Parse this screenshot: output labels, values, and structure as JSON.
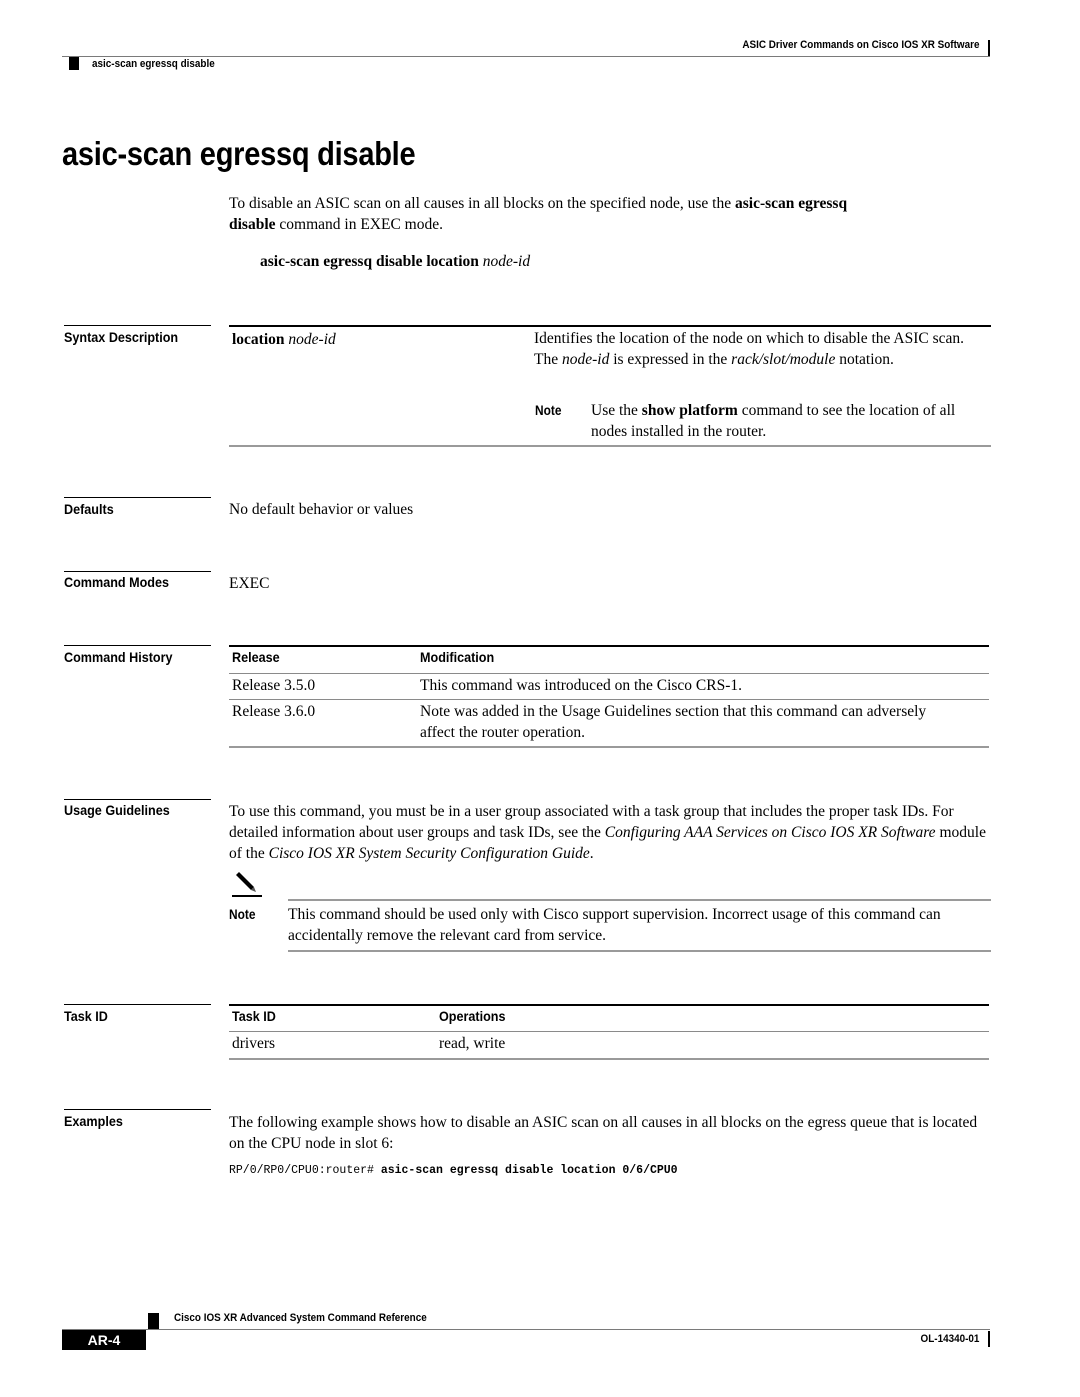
{
  "header": {
    "chapter": "ASIC Driver Commands on Cisco IOS XR Software",
    "running_title": "asic-scan egressq disable"
  },
  "title": "asic-scan egressq disable",
  "intro": {
    "text_1": "To disable an ASIC scan on all causes in all blocks on the specified node, use the ",
    "cmd_1": "asic-scan egressq",
    "cmd_2": "disable",
    "text_2": " command in EXEC mode."
  },
  "syntax": {
    "command": "asic-scan egressq disable location",
    "arg": "node-id"
  },
  "sections": {
    "syntax_description": "Syntax Description",
    "defaults": "Defaults",
    "command_modes": "Command Modes",
    "command_history": "Command History",
    "usage_guidelines": "Usage Guidelines",
    "task_id": "Task ID",
    "examples": "Examples"
  },
  "syntax_table": {
    "keyword": "location",
    "keyword_arg": "node-id",
    "desc_1": "Identifies the location of the node on which to disable the ASIC scan. The ",
    "desc_arg": "node-id",
    "desc_2": " is expressed in the ",
    "desc_fmt": "rack/slot/module",
    "desc_3": " notation.",
    "note_label": "Note",
    "note_1": "Use the ",
    "note_cmd": "show platform",
    "note_2": " command to see the location of all nodes installed in the router."
  },
  "defaults": "No default behavior or values",
  "command_modes": "EXEC",
  "history": {
    "headers": [
      "Release",
      "Modification"
    ],
    "rows": [
      {
        "release": "Release 3.5.0",
        "modification": "This command was introduced on the Cisco CRS-1."
      },
      {
        "release": "Release 3.6.0",
        "modification": "Note was added in the Usage Guidelines section that this command can adversely affect the router operation."
      }
    ]
  },
  "usage": {
    "text_1": "To use this command, you must be in a user group associated with a task group that includes the proper task IDs. For detailed information about user groups and task IDs, see the ",
    "ref_1": "Configuring AAA Services on Cisco IOS XR Software",
    "text_2": " module of the ",
    "ref_2": "Cisco IOS XR System Security Configuration Guide",
    "text_3": ".",
    "note_label": "Note",
    "note_text": "This command should be used only with Cisco support supervision. Incorrect usage of this command can accidentally remove the relevant card from service."
  },
  "task_table": {
    "headers": [
      "Task ID",
      "Operations"
    ],
    "rows": [
      {
        "task_id": "drivers",
        "operations": "read, write"
      }
    ]
  },
  "examples": {
    "text": "The following example shows how to disable an ASIC scan on all causes in all blocks on the egress queue that is located on the CPU node in slot 6:",
    "prompt": "RP/0/RP0/CPU0:router# ",
    "command": "asic-scan egressq disable location 0/6/CPU0"
  },
  "footer": {
    "book_title": "Cisco IOS XR Advanced System Command Reference",
    "page": "AR-4",
    "doc_id": "OL-14340-01"
  }
}
